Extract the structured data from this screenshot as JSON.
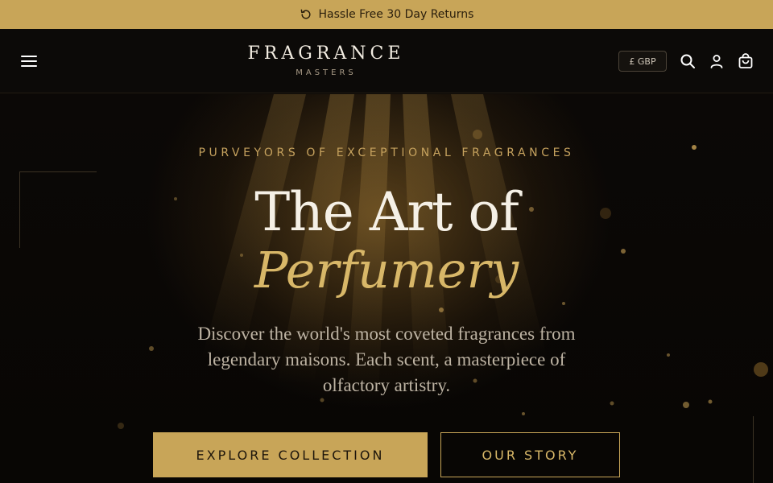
{
  "announcement": {
    "text": "Hassle Free 30 Day Returns",
    "icon": "refresh-icon"
  },
  "header": {
    "logo_main": "FRAGRANCE",
    "logo_sub": "MASTERS",
    "currency": "£ GBP",
    "icons": [
      "menu-icon",
      "search-icon",
      "account-icon",
      "cart-icon"
    ]
  },
  "hero": {
    "eyebrow": "PURVEYORS OF EXCEPTIONAL FRAGRANCES",
    "headline": "The Art of",
    "headline_accent": "Perfumery",
    "description": "Discover the world's most coveted fragrances from legendary maisons. Each scent, a masterpiece of olfactory artistry.",
    "primary_button": "EXPLORE COLLECTION",
    "secondary_button": "OUR STORY"
  },
  "colors": {
    "gold": "#c8a558",
    "gold_light": "#d8b768",
    "background": "#0b0806",
    "text_light": "#f5f0e6"
  }
}
